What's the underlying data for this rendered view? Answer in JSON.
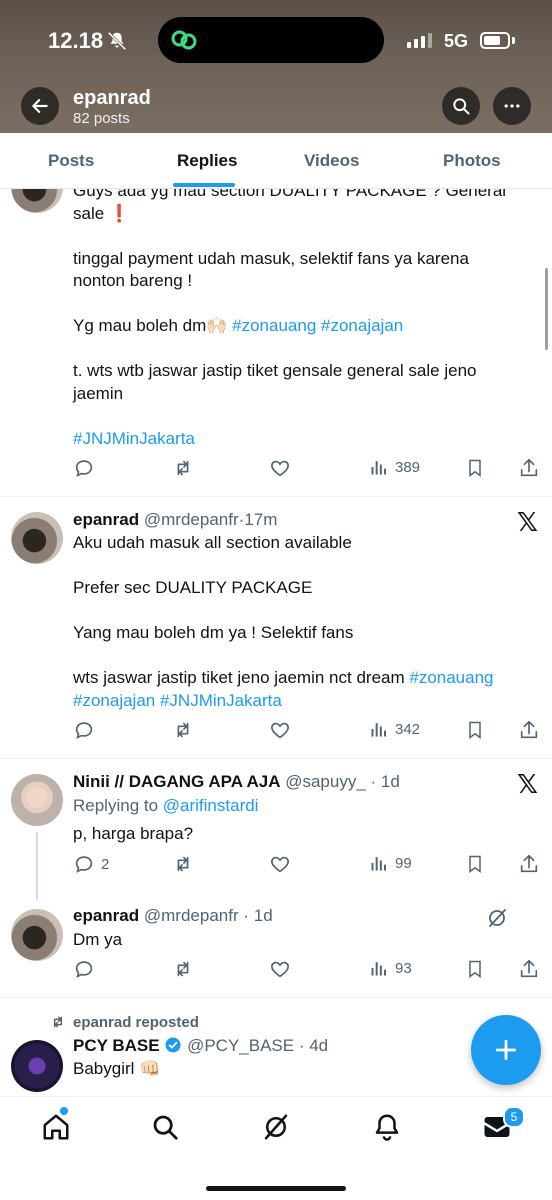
{
  "status_bar": {
    "time": "12.18",
    "network": "5G"
  },
  "profile": {
    "name": "epanrad",
    "posts": "82 posts"
  },
  "tabs": [
    {
      "label": "Posts"
    },
    {
      "label": "Replies"
    },
    {
      "label": "Videos"
    },
    {
      "label": "Photos"
    }
  ],
  "tweet1": {
    "line1": "Guys ada yg mau section DUALITY PACKAGE ? General",
    "line2": "sale ❗",
    "para2": "tinggal payment udah masuk, selektif fans ya karena\nnonton bareng !",
    "para3_text": "Yg mau boleh dm🙌🏻 ",
    "para3_tags": "#zonauang #zonajajan",
    "para4": "t. wts wtb jaswar jastip tiket gensale general sale jeno\njaemin",
    "hashtag": "#JNJMinJakarta",
    "views": "389"
  },
  "tweet2": {
    "name": "epanrad",
    "handle": "@mrdepanfr",
    "time": "17m",
    "para1": "Aku udah masuk all section available",
    "para2": "Prefer sec DUALITY PACKAGE",
    "para3": "Yang mau boleh dm ya ! Selektif fans",
    "para4_text": "wts jaswar jastip tiket jeno jaemin nct dream ",
    "para4_tag1": "#zonauang",
    "para4_tags2": "#zonajajan #JNJMinJakarta",
    "views": "342"
  },
  "tweet3": {
    "name": "Ninii // DAGANG APA AJA",
    "handle": "@sapuyy_",
    "time": "1d",
    "replying_label": "Replying to ",
    "replying_to": "@arifinstardi",
    "text": "p, harga brapa?",
    "replies": "2",
    "views": "99"
  },
  "tweet4": {
    "name": "epanrad",
    "handle": "@mrdepanfr",
    "time": "1d",
    "text": "Dm ya",
    "views": "93"
  },
  "tweet5": {
    "repost_label": "epanrad reposted",
    "name": "PCY BASE",
    "handle": "@PCY_BASE",
    "time": "4d",
    "text": "Babygirl 👊🏻"
  },
  "nav": {
    "messages_badge": "5"
  },
  "colors": {
    "accent": "#1d9bf0",
    "text": "#0f1419",
    "muted": "#536471"
  },
  "icons": [
    "back-arrow-icon",
    "search-icon",
    "more-icon",
    "reply-icon",
    "repost-icon",
    "like-icon",
    "views-icon",
    "bookmark-icon",
    "share-icon",
    "x-logo-icon",
    "grok-icon",
    "plus-icon",
    "home-icon",
    "notifications-icon",
    "messages-icon",
    "verified-icon"
  ]
}
